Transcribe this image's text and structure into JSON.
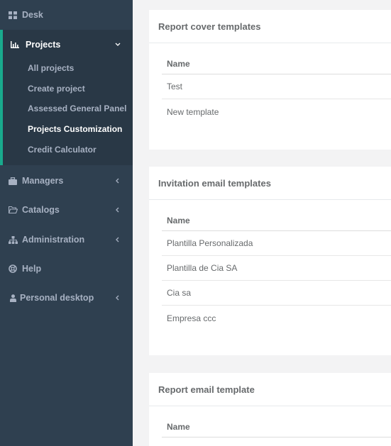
{
  "sidebar": {
    "desk": {
      "label": "Desk",
      "icon": "grid-icon"
    },
    "projects": {
      "label": "Projects",
      "icon": "bar-chart-icon",
      "submenu": [
        "All projects",
        "Create project",
        "Assessed General Panel",
        "Projects Customization",
        "Credit Calculator"
      ],
      "active_sub": "Projects Customization"
    },
    "managers": {
      "label": "Managers",
      "icon": "briefcase-icon"
    },
    "catalogs": {
      "label": "Catalogs",
      "icon": "folder-open-icon"
    },
    "administration": {
      "label": "Administration",
      "icon": "sitemap-icon"
    },
    "help": {
      "label": "Help",
      "icon": "life-ring-icon"
    },
    "personal": {
      "label": "Personal desktop",
      "icon": "user-icon"
    }
  },
  "panels": {
    "cover": {
      "title": "Report cover templates",
      "column": "Name",
      "rows": [
        "Test",
        "New template"
      ]
    },
    "invitation": {
      "title": "Invitation email templates",
      "column": "Name",
      "rows": [
        "Plantilla Personalizada",
        "Plantilla de Cia SA",
        "Cia sa",
        "Empresa ccc"
      ]
    },
    "report_email": {
      "title": "Report email template",
      "column": "Name",
      "rows": []
    }
  },
  "colors": {
    "sidebar": "#2f4050",
    "sidebar_active": "#293846",
    "accent": "#19aa8d",
    "text": "#676a6c"
  }
}
